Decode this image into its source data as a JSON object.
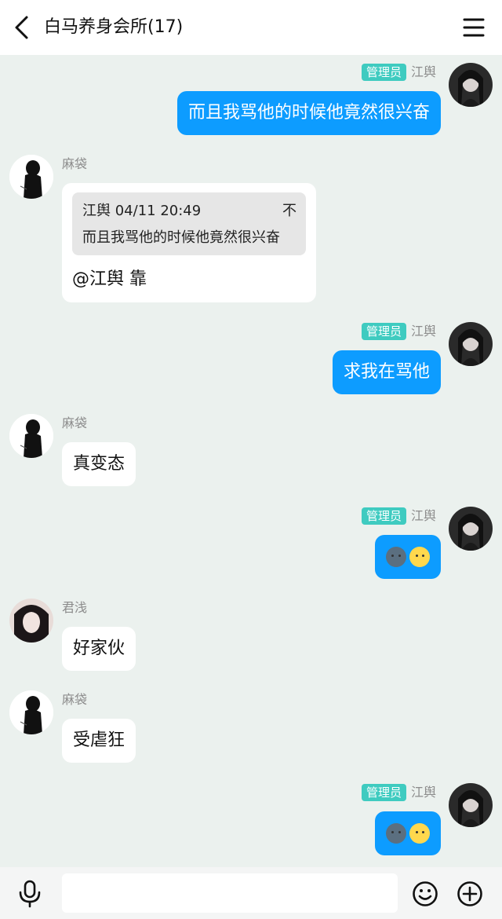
{
  "header": {
    "title": "白马养身会所(17)",
    "back_icon": "chevron-left-icon",
    "menu_icon": "hamburger-menu-icon"
  },
  "messages": [
    {
      "side": "right",
      "sender": "江舆",
      "badge": "管理员",
      "text": "而且我骂他的时候他竟然很兴奋"
    },
    {
      "side": "left",
      "sender": "麻袋",
      "quote": {
        "author": "江舆",
        "time": "04/11 20:49",
        "text": "而且我骂他的时候他竟然很兴奋",
        "icon": "pin-top-icon",
        "icon_glyph": "不"
      },
      "text": "@江舆 靠"
    },
    {
      "side": "right",
      "sender": "江舆",
      "badge": "管理员",
      "text": "求我在骂他"
    },
    {
      "side": "left",
      "sender": "麻袋",
      "text": "真变态"
    },
    {
      "side": "right",
      "sender": "江舆",
      "badge": "管理员",
      "emojis": [
        "new-moon-face-icon",
        "full-moon-face-icon"
      ]
    },
    {
      "side": "left",
      "sender": "君浅",
      "text": "好家伙"
    },
    {
      "side": "left",
      "sender": "麻袋",
      "text": "受虐狂"
    },
    {
      "side": "right",
      "sender": "江舆",
      "badge": "管理员",
      "emojis": [
        "new-moon-face-icon",
        "full-moon-face-icon"
      ]
    }
  ],
  "input_bar": {
    "placeholder": "",
    "mic_icon": "microphone-icon",
    "emoji_icon": "smiley-icon",
    "plus_icon": "plus-circle-icon"
  },
  "colors": {
    "background": "#ebf1ee",
    "sent_bubble": "#0d9cff",
    "admin_badge": "#3fcbc0"
  }
}
